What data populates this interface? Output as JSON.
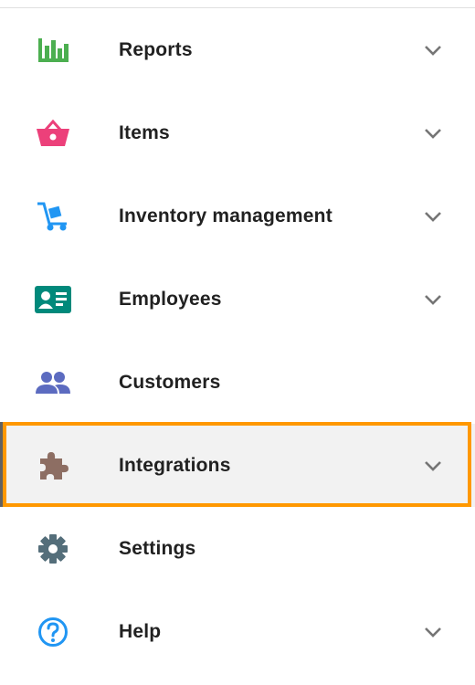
{
  "menu": {
    "items": [
      {
        "label": "Reports",
        "icon": "bar-chart-icon",
        "icon_color": "#4caf50",
        "has_chevron": true
      },
      {
        "label": "Items",
        "icon": "basket-icon",
        "icon_color": "#ec407a",
        "has_chevron": true
      },
      {
        "label": "Inventory management",
        "icon": "hand-truck-icon",
        "icon_color": "#2196f3",
        "has_chevron": true
      },
      {
        "label": "Employees",
        "icon": "id-card-icon",
        "icon_color": "#00897b",
        "has_chevron": true
      },
      {
        "label": "Customers",
        "icon": "people-icon",
        "icon_color": "#5c6bc0",
        "has_chevron": false
      },
      {
        "label": "Integrations",
        "icon": "puzzle-icon",
        "icon_color": "#8d6e63",
        "has_chevron": true,
        "highlighted": true
      },
      {
        "label": "Settings",
        "icon": "gear-icon",
        "icon_color": "#546e7a",
        "has_chevron": false
      },
      {
        "label": "Help",
        "icon": "help-circle-icon",
        "icon_color": "#2196f3",
        "has_chevron": true
      }
    ]
  },
  "colors": {
    "highlight_border": "#ff9800",
    "highlight_background": "#f2f2f2",
    "chevron": "#757575",
    "text": "#212121"
  }
}
